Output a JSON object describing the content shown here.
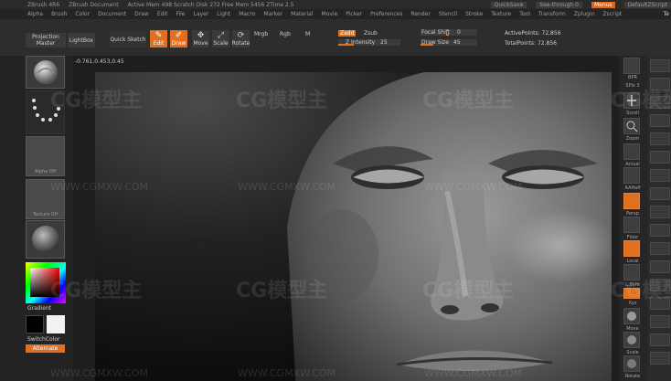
{
  "titlebar": {
    "app": "ZBrush 4R6",
    "doc": "ZBrush Document",
    "stats": "Active Mem 498  Scratch Disk 272  Free Mem 5456  ZTime 2.5",
    "quicksave": "QuickSave",
    "seethrough": "See-through  0",
    "menus": "Menus",
    "script": "DefaultZScript"
  },
  "menubar": {
    "items": [
      "Alpha",
      "Brush",
      "Color",
      "Document",
      "Draw",
      "Edit",
      "File",
      "Layer",
      "Light",
      "Macro",
      "Marker",
      "Material",
      "Movie",
      "Picker",
      "Preferences",
      "Render",
      "Stencil",
      "Stroke",
      "Texture",
      "Tool",
      "Transform",
      "Zplugin",
      "Zscript"
    ],
    "config": "Te"
  },
  "shelf": {
    "projection_master": "Projection Master",
    "lightbox": "LightBox",
    "quick_sketch": "Quick Sketch",
    "edit": "Edit",
    "draw": "Draw",
    "move": "Move",
    "scale": "Scale",
    "rotate": "Rotate",
    "rgb": "Rgb",
    "mrgb": "Mrgb",
    "m": "M",
    "zadd": "Zadd",
    "zsub": "Zsub",
    "z_intensity_label": "Z Intensity",
    "z_intensity_value": "25",
    "focal_shift_label": "Focal Shift",
    "focal_shift_value": "0",
    "draw_size_label": "Draw Size",
    "draw_size_value": "45",
    "active_points": "ActivePoints: 72,856",
    "total_points": "TotalPoints: 72,856"
  },
  "left": {
    "gradient": "Gradient",
    "switch_color": "SwitchColor",
    "alternate": "Alternate",
    "tile_caps": [
      "",
      "",
      "Alpha Off",
      "Texture Off",
      ""
    ]
  },
  "canvas": {
    "coords": "-0.761,0.453,0.45"
  },
  "right": {
    "labels": [
      "BPR",
      "SPix 3",
      "Scroll",
      "Zoom",
      "Actual",
      "AAHalf",
      "Persp",
      "Floor",
      "Local",
      "L.Sym",
      "Xyz",
      "Move",
      "Scale",
      "Rotate"
    ]
  },
  "watermark": {
    "logo": "CG模型主",
    "site": "WWW.CGMXW.COM"
  },
  "colors": {
    "accent": "#e0701f",
    "panel": "#2d2d2d",
    "bg": "#1b1b1b"
  }
}
